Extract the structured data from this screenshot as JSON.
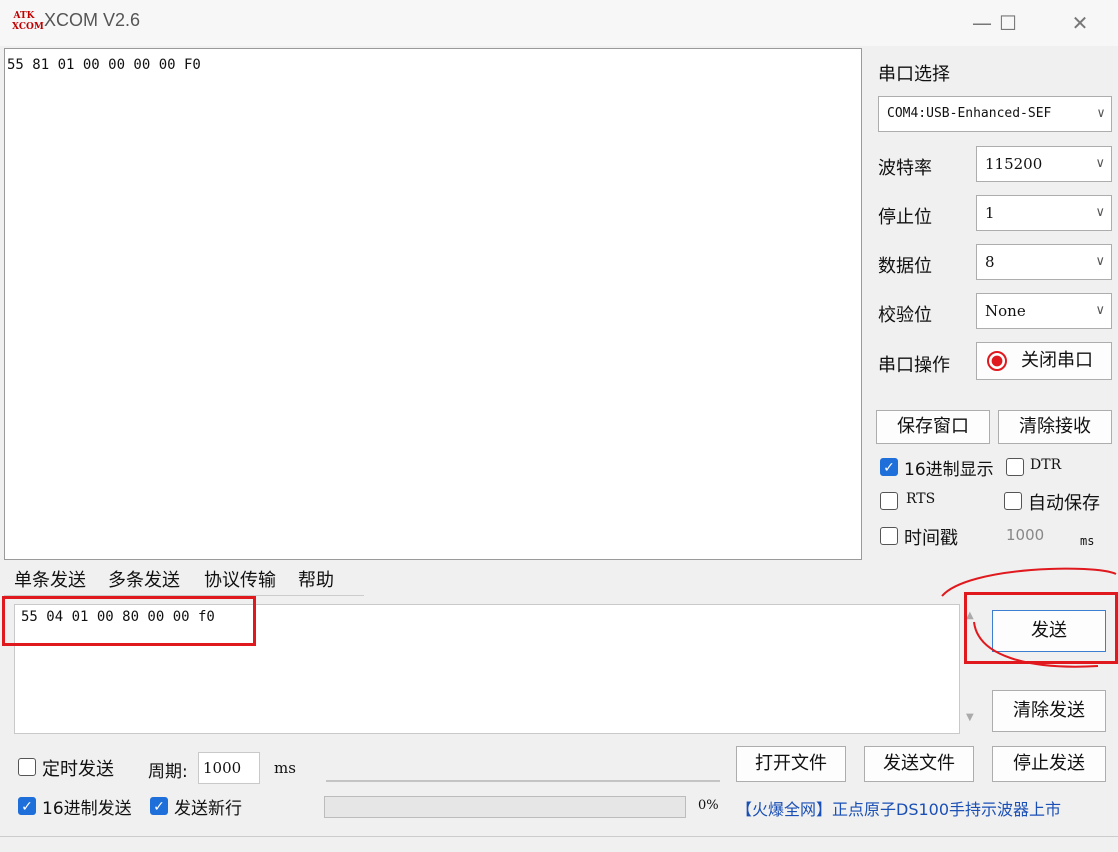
{
  "window": {
    "logo": "ATK XCOM",
    "title": "XCOM V2.6"
  },
  "receive": {
    "text": "55 81 01 00 00 00 00 F0"
  },
  "serial": {
    "port_label": "串口选择",
    "port_value": "COM4:USB-Enhanced-SEF",
    "baud_label": "波特率",
    "baud_value": "115200",
    "stop_label": "停止位",
    "stop_value": "1",
    "data_label": "数据位",
    "data_value": "8",
    "parity_label": "校验位",
    "parity_value": "None",
    "op_label": "串口操作",
    "op_button": "关闭串口"
  },
  "recv_controls": {
    "save_window": "保存窗口",
    "clear_receive": "清除接收",
    "hex_display": "16进制显示",
    "dtr": "DTR",
    "rts": "RTS",
    "auto_save": "自动保存",
    "timestamp": "时间戳",
    "timestamp_value": "1000",
    "timestamp_unit": "ms"
  },
  "tabs": [
    "单条发送",
    "多条发送",
    "协议传输",
    "帮助"
  ],
  "send": {
    "text": "55 04 01 00 80 00 00 f0",
    "send_button": "发送",
    "clear_send": "清除发送"
  },
  "bottom": {
    "timed_send": "定时发送",
    "period_label": "周期:",
    "period_value": "1000",
    "period_unit": "ms",
    "open_file": "打开文件",
    "send_file": "发送文件",
    "stop_send": "停止发送",
    "hex_send": "16进制发送",
    "send_newline": "发送新行",
    "progress": "0%",
    "promo": "【火爆全网】正点原子DS100手持示波器上市"
  },
  "colors": {
    "accent": "#1e6fd9",
    "highlight_red": "#e0191e",
    "promo_blue": "#1a4fb5"
  }
}
